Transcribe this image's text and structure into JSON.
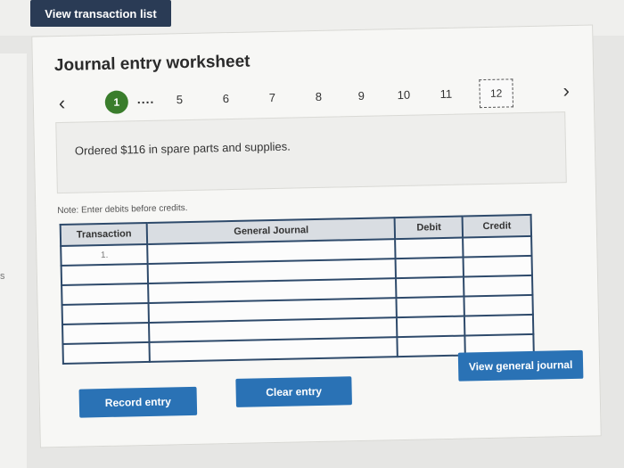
{
  "top_button": {
    "label": "View transaction list"
  },
  "worksheet": {
    "title": "Journal entry worksheet",
    "pager": {
      "prev_icon": "chevron-left-icon",
      "current": "1",
      "ellipsis": "....",
      "pages": [
        "5",
        "6",
        "7",
        "8",
        "9",
        "10",
        "11"
      ],
      "boxed_page": "12",
      "next_icon": "chevron-right-icon"
    },
    "question": "Ordered $116 in spare parts and supplies.",
    "note": "Note: Enter debits before credits.",
    "table": {
      "headers": [
        "Transaction",
        "General Journal",
        "Debit",
        "Credit"
      ],
      "rows": [
        {
          "transaction": "1.",
          "general_journal": "",
          "debit": "",
          "credit": ""
        },
        {
          "transaction": "",
          "general_journal": "",
          "debit": "",
          "credit": ""
        },
        {
          "transaction": "",
          "general_journal": "",
          "debit": "",
          "credit": ""
        },
        {
          "transaction": "",
          "general_journal": "",
          "debit": "",
          "credit": ""
        },
        {
          "transaction": "",
          "general_journal": "",
          "debit": "",
          "credit": ""
        },
        {
          "transaction": "",
          "general_journal": "",
          "debit": "",
          "credit": ""
        }
      ]
    },
    "buttons": {
      "record": "Record entry",
      "clear": "Clear entry",
      "view_journal": "View general journal"
    }
  },
  "left_edge_mark": "s",
  "colors": {
    "button_blue": "#2a72b5",
    "top_button_navy": "#2a3b55",
    "current_page_green": "#3a7d2c",
    "table_border": "#2e4a6b"
  }
}
